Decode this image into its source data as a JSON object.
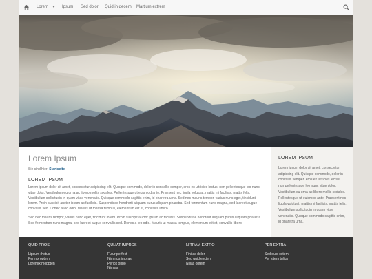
{
  "nav": {
    "items": [
      "Lorem",
      "Ipsum",
      "Sed dolor",
      "Quid in decem",
      "Martium extrem"
    ]
  },
  "icons": {
    "home": "home-icon",
    "search": "search-icon",
    "dropdown": "caret-down-icon"
  },
  "hero": {
    "image": "mountain-landscape-photo"
  },
  "main": {
    "title": "Lorem Ipsum",
    "breadcrumb_prefix": "Sie sind hier: ",
    "breadcrumb_link": "Startseite",
    "heading": "LOREM IPSUM",
    "paragraph1": "Lorem ipsum dolor sit amet, consectetur adipiscing elit. Quisque commodo, dolor in convallis semper, eros ex ultricies lectus, non pellentesque leo nunc vitae dolor. Vestibulum eu urna ac libero mollis sodales. Pellentesque ut euismod ante. Praesent nec ligula volutpat, mattis mi facilisis, mattis felis. Vestibulum sollicitudin in quam vitae venenatis. Quisque commodo sagittis enim, id pharetra urna. Sed nec mauris tempor, varius nunc eget, tincidunt lorem. Proin suscipit auctor ipsum ac facilisis. Suspendisse hendrerit aliquam purus aliquam pharetra. Sed fermentum nunc magna, sed laoreet augue convallis sed. Donec a leo odio. Mauris ut massa tempus, elementum elit et, convallis libero.",
    "paragraph2": "Sed nec mauris tempor, varius nunc eget, tincidunt lorem. Proin suscipit auctor ipsum ac facilisis. Suspendisse hendrerit aliquam purus aliquam pharetra. Sed fermentum nunc magna, sed laoreet augue convallis sed. Donec a leo odio. Mauris ut massa tempus, elementum elit et, convallis libero."
  },
  "sidebar": {
    "heading": "LOREM IPSUM",
    "text": "Lorem ipsum dolor sit amet, consectetur adipiscing elit. Quisque commodo, dolor in convallis semper, eros ex ultricies lectus, non pellentesque leo nunc vitae dolor. Vestibulum eu urna ac libero mollis sodales. Pellentesque ut euismod ante. Praesent nec ligula volutpat, mattis mi facilisis, mattis felis. Vestibulum sollicitudin in quam vitae venenatis. Quisque commodo sagittis enim, id pharetra urna."
  },
  "footer": {
    "columns": [
      {
        "title": "QUID PROS",
        "links": [
          "Lipsum rhetus",
          "Permix optem",
          "Loremix moppten"
        ]
      },
      {
        "title": "QULIAT IMPROS",
        "links": [
          "Futur perfect",
          "Nimmus impras",
          "Perlox oppo",
          "Nimias"
        ]
      },
      {
        "title": "NITRAM EXTRO",
        "links": [
          "Finitas dolor",
          "Sed quid exctem",
          "Nillas optem"
        ]
      },
      {
        "title": "PER EXTRA",
        "links": [
          "Sed quid octem",
          "Per sitem tulius"
        ]
      }
    ]
  },
  "colors": {
    "nav_bg": "#f7f7f7",
    "breadcrumb_link": "#1f5f8b",
    "sidebar_bg": "#f3f2ef",
    "footer_bg": "#353535",
    "page_bg": "#e4e1dc"
  }
}
